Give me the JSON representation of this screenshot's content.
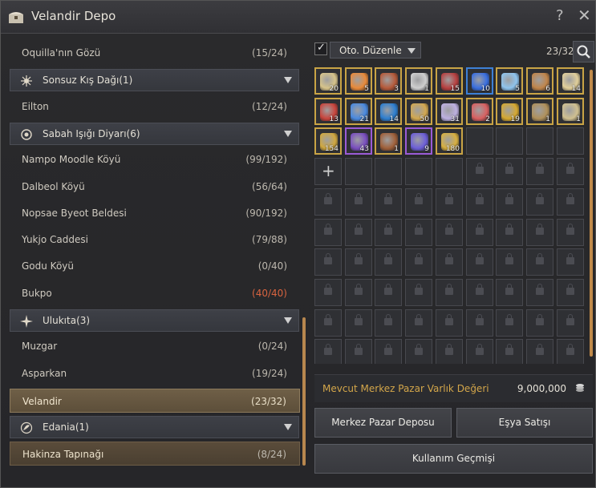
{
  "window": {
    "title": "Velandir Depo",
    "help": "?",
    "close": "✕"
  },
  "list": {
    "rows": [
      {
        "type": "item",
        "label": "Oquilla'nın Gözü",
        "count": "(15/24)"
      },
      {
        "type": "group",
        "label": "Sonsuz Kış Dağı(1)",
        "icon": "snowflake-sun-icon"
      },
      {
        "type": "item",
        "label": "Eilton",
        "count": "(12/24)"
      },
      {
        "type": "group",
        "label": "Sabah Işığı Diyarı(6)",
        "icon": "sun-emblem-icon"
      },
      {
        "type": "item",
        "label": "Nampo Moodle Köyü",
        "count": "(99/192)"
      },
      {
        "type": "item",
        "label": "Dalbeol Köyü",
        "count": "(56/64)"
      },
      {
        "type": "item",
        "label": "Nopsae Byeot Beldesi",
        "count": "(90/192)"
      },
      {
        "type": "item",
        "label": "Yukjo Caddesi",
        "count": "(79/88)"
      },
      {
        "type": "item",
        "label": "Godu Köyü",
        "count": "(0/40)"
      },
      {
        "type": "item",
        "label": "Bukpo",
        "count": "(40/40)",
        "full": true
      },
      {
        "type": "group",
        "label": "Ulukıta(3)",
        "icon": "star-compass-icon"
      },
      {
        "type": "item",
        "label": "Muzgar",
        "count": "(0/24)"
      },
      {
        "type": "item",
        "label": "Asparkan",
        "count": "(19/24)"
      },
      {
        "type": "item",
        "label": "Velandir",
        "count": "(23/32)",
        "selected": true
      },
      {
        "type": "group",
        "label": "Edania(1)",
        "icon": "leaf-emblem-icon"
      },
      {
        "type": "item",
        "label": "Hakinza Tapınağı",
        "count": "(8/24)",
        "highlight": true
      }
    ]
  },
  "storage": {
    "auto_sort_checked": true,
    "sort_label": "Oto. Düzenle",
    "capacity": "23/32",
    "items": [
      {
        "icon": "scroll-map-icon",
        "qty": "20",
        "color": "#c9a445"
      },
      {
        "icon": "cocktail-icon",
        "qty": "5",
        "color": "#c9a445"
      },
      {
        "icon": "tools-icon",
        "qty": "3",
        "color": "#c9a445"
      },
      {
        "icon": "potion-flask-icon",
        "qty": "1",
        "color": "#c9a445"
      },
      {
        "icon": "red-orb-icon",
        "qty": "15",
        "color": "#c9a445"
      },
      {
        "icon": "blue-crystal-icon",
        "qty": "10",
        "color": "#3d80d6"
      },
      {
        "icon": "snowflake-icon",
        "qty": "5",
        "color": "#c9a445"
      },
      {
        "icon": "horn-icon",
        "qty": "6",
        "color": "#c9a445"
      },
      {
        "icon": "scroll-icon",
        "qty": "14",
        "color": "#c9a445"
      },
      {
        "icon": "candy-cane-icon",
        "qty": "13",
        "color": "#c9a445"
      },
      {
        "icon": "blue-potion-icon",
        "qty": "21",
        "color": "#c9a445"
      },
      {
        "icon": "flask-icon",
        "qty": "14",
        "color": "#c9a445"
      },
      {
        "icon": "ticket-icon",
        "qty": "50",
        "color": "#c9a445"
      },
      {
        "icon": "key-icon",
        "qty": "31",
        "color": "#c9a445"
      },
      {
        "icon": "hearts-icon",
        "qty": "2",
        "color": "#c9a445"
      },
      {
        "icon": "gold-coin-icon",
        "qty": "19",
        "color": "#c9a445"
      },
      {
        "icon": "medallion-icon",
        "qty": "1",
        "color": "#c9a445"
      },
      {
        "icon": "letter-icon",
        "qty": "1",
        "color": "#c9a445"
      },
      {
        "icon": "gold-chest-icon",
        "qty": "154",
        "color": "#c9a445"
      },
      {
        "icon": "purple-box-icon",
        "qty": "43",
        "color": "#9b5bd6"
      },
      {
        "icon": "treasure-chest-icon",
        "qty": "1",
        "color": "#c9a445"
      },
      {
        "icon": "crystal-shard-icon",
        "qty": "9",
        "color": "#9b5bd6"
      },
      {
        "icon": "gold-shard-icon",
        "qty": "180",
        "color": "#c9a445"
      }
    ]
  },
  "market": {
    "label": "Mevcut Merkez Pazar Varlık Değeri",
    "value": "9,000,000"
  },
  "buttons": {
    "market_storage": "Merkez Pazar Deposu",
    "item_sale": "Eşya Satışı",
    "usage_history": "Kullanım Geçmişi"
  }
}
